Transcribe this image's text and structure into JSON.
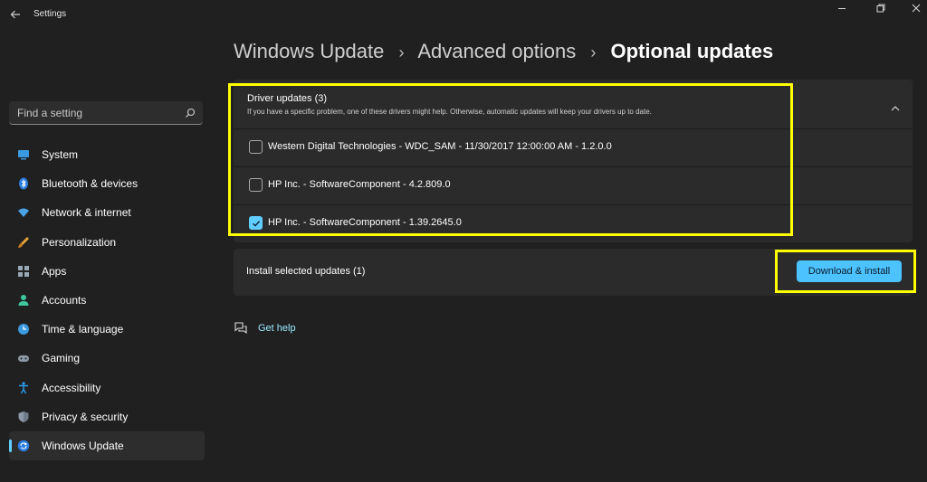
{
  "window": {
    "title": "Settings",
    "back_icon": "back-arrow-icon",
    "controls": [
      "minimize-icon",
      "restore-icon",
      "close-icon"
    ]
  },
  "search": {
    "placeholder": "Find a setting",
    "icon": "search-icon"
  },
  "sidebar": {
    "items": [
      {
        "label": "System",
        "icon": "system-icon",
        "active": false
      },
      {
        "label": "Bluetooth & devices",
        "icon": "bluetooth-icon",
        "active": false
      },
      {
        "label": "Network & internet",
        "icon": "wifi-icon",
        "active": false
      },
      {
        "label": "Personalization",
        "icon": "brush-icon",
        "active": false
      },
      {
        "label": "Apps",
        "icon": "apps-icon",
        "active": false
      },
      {
        "label": "Accounts",
        "icon": "person-icon",
        "active": false
      },
      {
        "label": "Time & language",
        "icon": "globe-clock-icon",
        "active": false
      },
      {
        "label": "Gaming",
        "icon": "gamepad-icon",
        "active": false
      },
      {
        "label": "Accessibility",
        "icon": "accessibility-icon",
        "active": false
      },
      {
        "label": "Privacy & security",
        "icon": "shield-icon",
        "active": false
      },
      {
        "label": "Windows Update",
        "icon": "update-icon",
        "active": true
      }
    ]
  },
  "breadcrumb": {
    "items": [
      "Windows Update",
      "Advanced options",
      "Optional updates"
    ],
    "separator": "›"
  },
  "driver_updates": {
    "title": "Driver updates (3)",
    "description": "If you have a specific problem, one of these drivers might help. Otherwise, automatic updates will keep your drivers up to date.",
    "expanded": true,
    "items": [
      {
        "label": "Western Digital Technologies - WDC_SAM - 11/30/2017 12:00:00 AM - 1.2.0.0",
        "checked": false
      },
      {
        "label": "HP Inc. - SoftwareComponent - 4.2.809.0",
        "checked": false
      },
      {
        "label": "HP Inc. - SoftwareComponent - 1.39.2645.0",
        "checked": true
      }
    ]
  },
  "install": {
    "label": "Install selected updates (1)",
    "button_label": "Download & install"
  },
  "help": {
    "label": "Get help",
    "icon": "help-chat-icon"
  },
  "colors": {
    "background": "#202020",
    "card": "#2b2b2b",
    "accent": "#4cc2ff",
    "highlight": "#ffff00",
    "link": "#99ebff"
  }
}
